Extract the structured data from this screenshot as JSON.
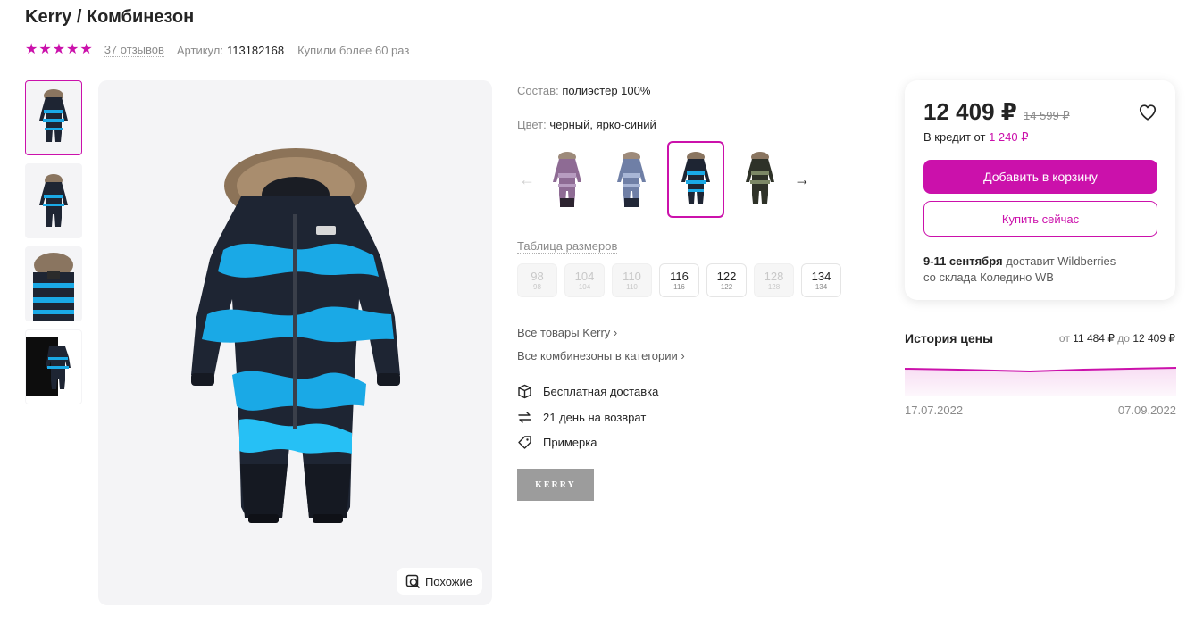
{
  "product": {
    "title": "Kerry / Комбинезон",
    "rating": 5,
    "reviews": "37 отзывов",
    "article_label": "Артикул:",
    "article_value": "113182168",
    "bought": "Купили более 60 раз"
  },
  "gallery": {
    "similar_label": "Похожие"
  },
  "details": {
    "composition_label": "Состав:",
    "composition_value": "полиэстер 100%",
    "color_label": "Цвет:",
    "color_value": "черный, ярко-синий",
    "size_table_label": "Таблица размеров",
    "sizes": [
      {
        "main": "98",
        "sub": "98",
        "available": false
      },
      {
        "main": "104",
        "sub": "104",
        "available": false
      },
      {
        "main": "110",
        "sub": "110",
        "available": false
      },
      {
        "main": "116",
        "sub": "116",
        "available": true
      },
      {
        "main": "122",
        "sub": "122",
        "available": true
      },
      {
        "main": "128",
        "sub": "128",
        "available": false
      },
      {
        "main": "134",
        "sub": "134",
        "available": true
      }
    ],
    "link_brand": "Все товары Kerry",
    "link_category": "Все комбинезоны в категории",
    "features": [
      "Бесплатная доставка",
      "21 день на возврат",
      "Примерка"
    ],
    "brand_logo": "KERRY"
  },
  "price_card": {
    "price": "12 409 ₽",
    "old_price": "14 599 ₽",
    "credit_prefix": "В кредит от",
    "credit_value": "1 240 ₽",
    "add_to_cart": "Добавить в корзину",
    "buy_now": "Купить сейчас",
    "delivery_date": "9-11 сентября",
    "delivery_by": "доставит Wildberries",
    "delivery_from": "со склада Коледино WB"
  },
  "price_history": {
    "title": "История цены",
    "from_label": "от",
    "from_value": "11 484 ₽",
    "to_label": "до",
    "to_value": "12 409 ₽",
    "date_start": "17.07.2022",
    "date_end": "07.09.2022"
  },
  "colors": {
    "accent": "#cb11ab",
    "suit_dark": "#1e2533",
    "suit_blue": "#1aa9e6"
  }
}
